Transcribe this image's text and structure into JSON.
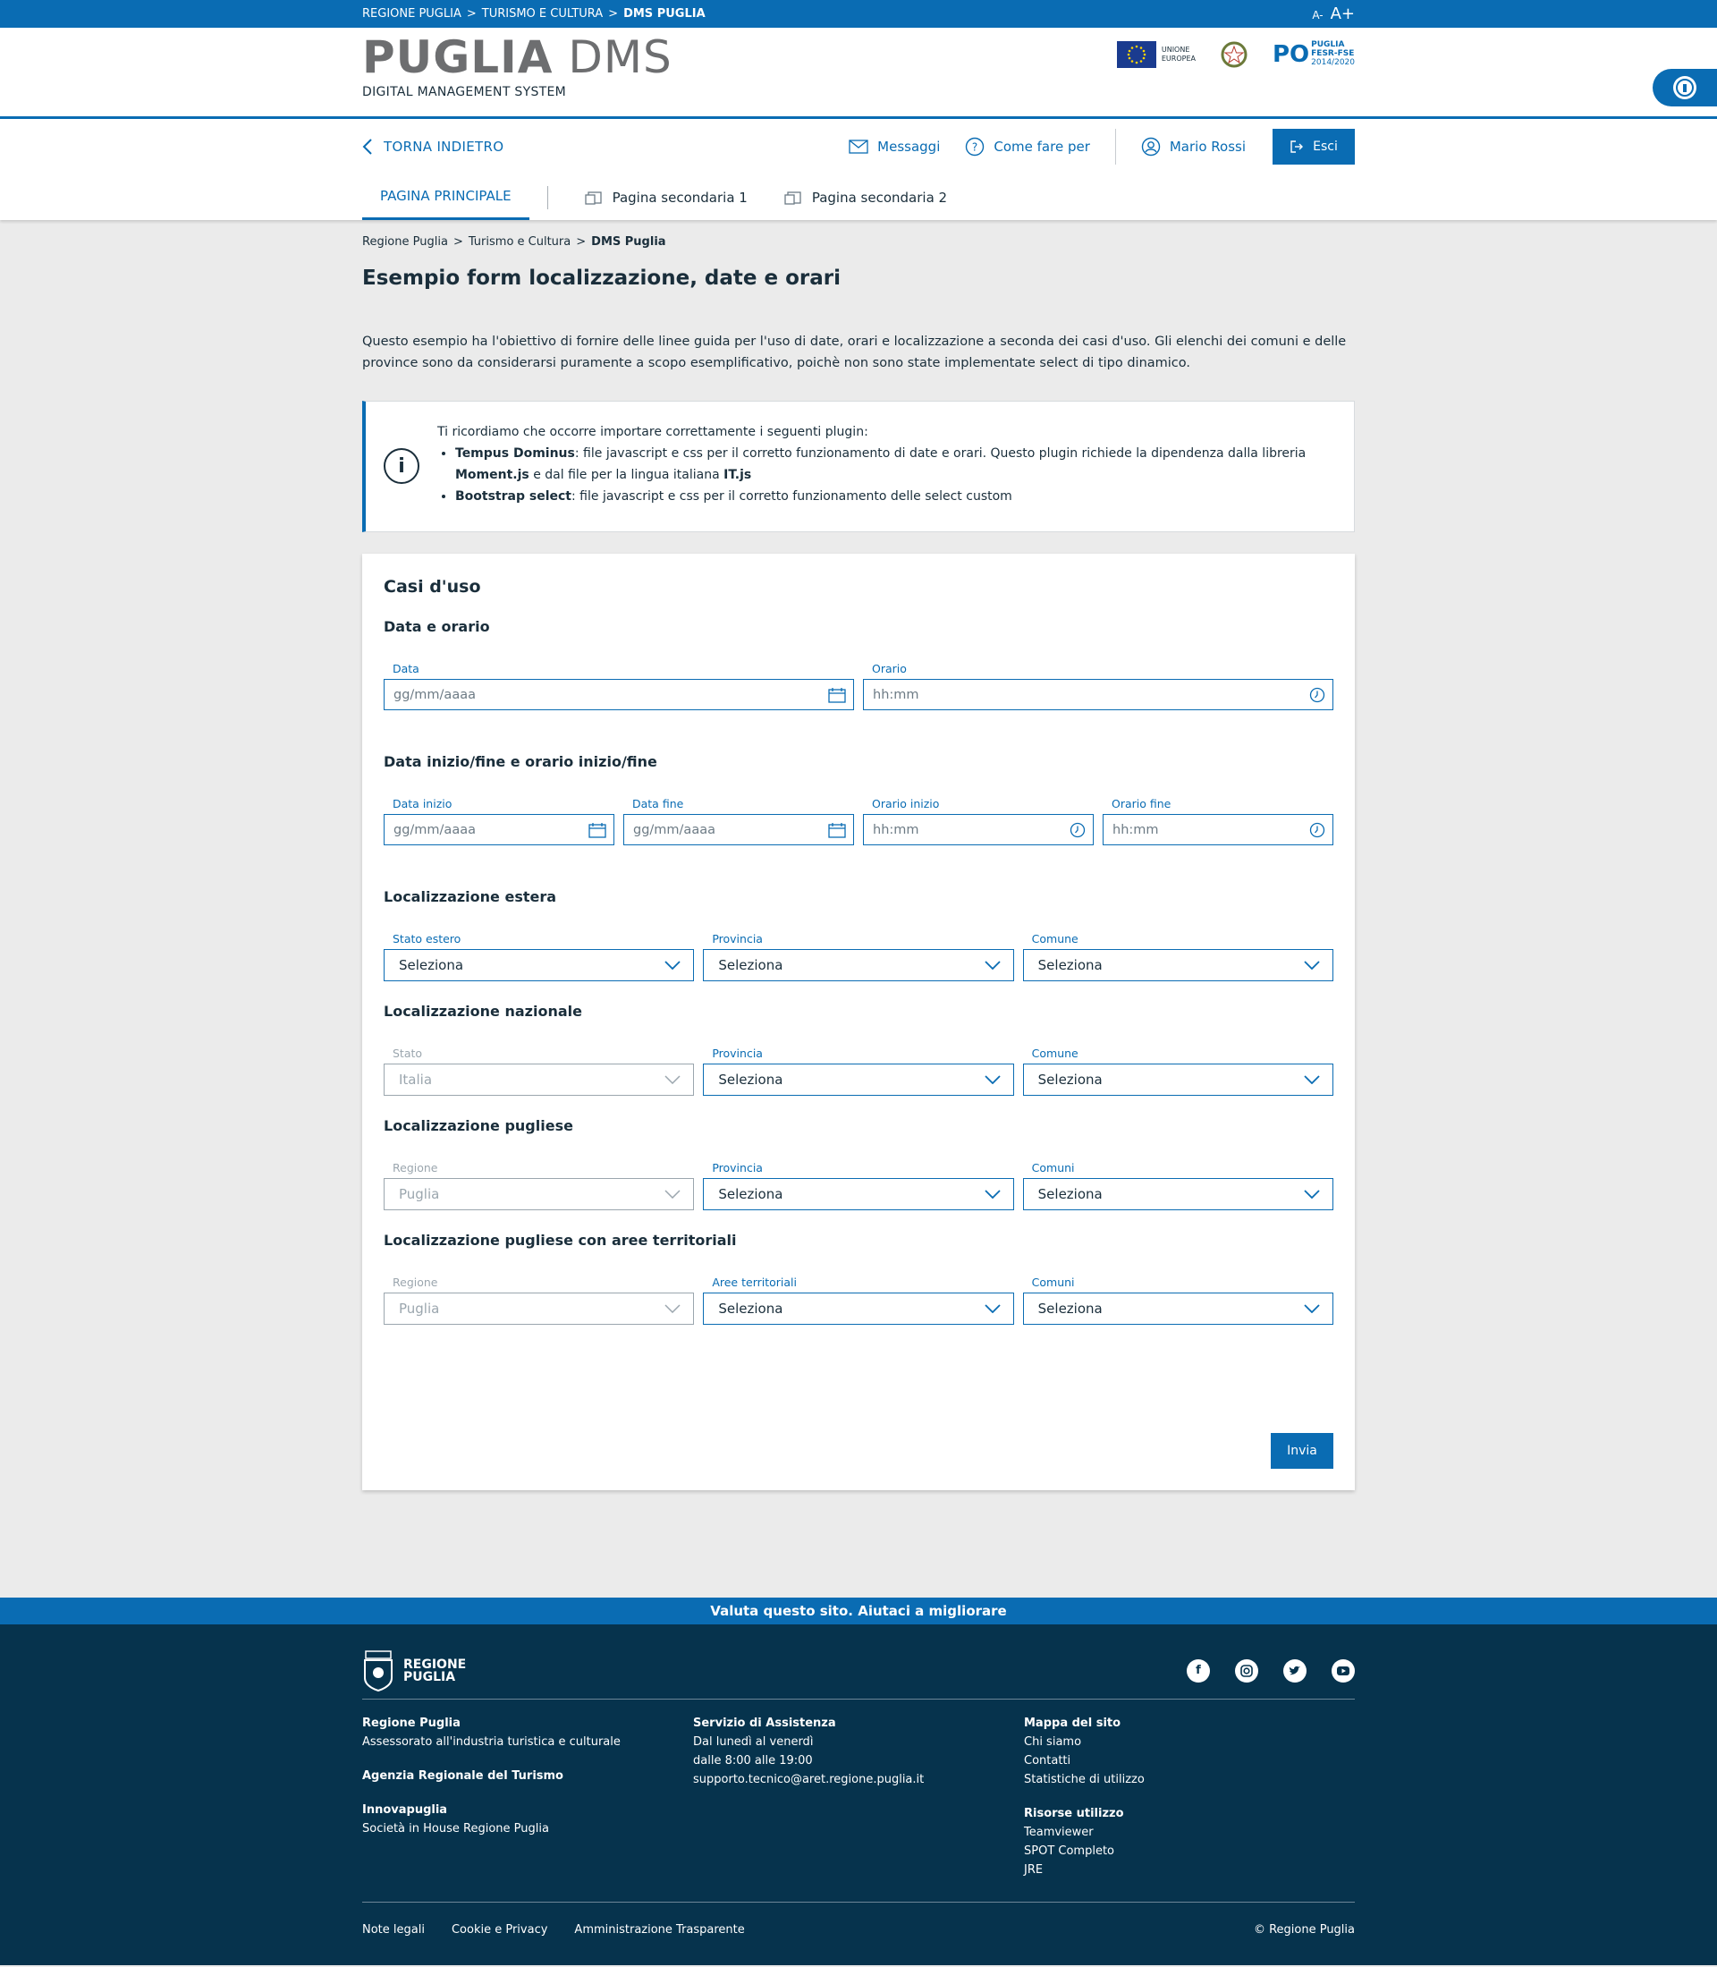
{
  "topbar": {
    "crumbs": [
      "REGIONE PUGLIA",
      "TURISMO E CULTURA",
      "DMS PUGLIA"
    ],
    "sep": ">",
    "font_smaller": "A-",
    "font_larger": "A+"
  },
  "header": {
    "logo_bold": "PUGLIA",
    "logo_light": "DMS",
    "logo_sub": "DIGITAL MANAGEMENT SYSTEM",
    "eu_line1": "UNIONE",
    "eu_line2": "EUROPEA",
    "po_letter": "PO",
    "po_line1": "PUGLIA",
    "po_line2": "FESR-FSE",
    "po_line3": "2014/2020"
  },
  "nav": {
    "back_label": "TORNA INDIETRO",
    "messages_label": "Messaggi",
    "howto_label": "Come fare per",
    "user_label": "Mario Rossi",
    "logout_label": "Esci",
    "tabs": [
      {
        "label": "PAGINA PRINCIPALE",
        "active": true
      },
      {
        "label": "Pagina secondaria 1",
        "active": false
      },
      {
        "label": "Pagina secondaria 2",
        "active": false
      }
    ]
  },
  "breadcrumb": [
    "Regione Puglia",
    "Turismo e Cultura",
    "DMS Puglia"
  ],
  "breadcrumb_sep": ">",
  "page": {
    "title": "Esempio form localizzazione, date e orari",
    "intro": "Questo esempio ha l'obiettivo di fornire delle linee guida per l'uso di date, orari e localizzazione a seconda dei casi d'uso. Gli elenchi dei comuni e delle province sono da considerarsi puramente a scopo esemplificativo, poichè non sono state implementate select di tipo dinamico."
  },
  "info": {
    "lead": "Ti ricordiamo che occorre importare correttamente i seguenti plugin:",
    "item1_bold": "Tempus Dominus",
    "item1_text": ": file javascript e css per il corretto funzionamento di date e orari. Questo plugin richiede la dipendenza dalla libreria ",
    "item1_bold2": "Moment.js",
    "item1_text2": " e dal file per la lingua italiana ",
    "item1_bold3": "IT.js",
    "item2_bold": "Bootstrap select",
    "item2_text": ": file javascript e css per il corretto funzionamento delle select custom"
  },
  "form": {
    "title": "Casi d'uso",
    "s1_title": "Data e orario",
    "s1_fields": [
      {
        "label": "Data",
        "placeholder": "gg/mm/aaaa"
      },
      {
        "label": "Orario",
        "placeholder": "hh:mm"
      }
    ],
    "s2_title": "Data inizio/fine e orario inizio/fine",
    "s2_fields": [
      {
        "label": "Data inizio",
        "placeholder": "gg/mm/aaaa"
      },
      {
        "label": "Data fine",
        "placeholder": "gg/mm/aaaa"
      },
      {
        "label": "Orario inizio",
        "placeholder": "hh:mm"
      },
      {
        "label": "Orario fine",
        "placeholder": "hh:mm"
      }
    ],
    "s3_title": "Localizzazione estera",
    "s3_fields": [
      {
        "label": "Stato estero",
        "value": "Seleziona"
      },
      {
        "label": "Provincia",
        "value": "Seleziona"
      },
      {
        "label": "Comune",
        "value": "Seleziona"
      }
    ],
    "s4_title": "Localizzazione nazionale",
    "s4_fields": [
      {
        "label": "Stato",
        "value": "Italia"
      },
      {
        "label": "Provincia",
        "value": "Seleziona"
      },
      {
        "label": "Comune",
        "value": "Seleziona"
      }
    ],
    "s5_title": "Localizzazione pugliese",
    "s5_fields": [
      {
        "label": "Regione",
        "value": "Puglia"
      },
      {
        "label": "Provincia",
        "value": "Seleziona"
      },
      {
        "label": "Comuni",
        "value": "Seleziona"
      }
    ],
    "s6_title": "Localizzazione pugliese con aree territoriali",
    "s6_fields": [
      {
        "label": "Regione",
        "value": "Puglia"
      },
      {
        "label": "Aree territoriali",
        "value": "Seleziona"
      },
      {
        "label": "Comuni",
        "value": "Seleziona"
      }
    ],
    "submit_label": "Invia"
  },
  "footer": {
    "feedback": "Valuta questo sito. Aiutaci a migliorare",
    "logo_line1": "REGIONE",
    "logo_line2": "PUGLIA",
    "col1": {
      "h1": "Regione Puglia",
      "t1": "Assessorato all'industria turistica e culturale",
      "h2": "Agenzia Regionale del Turismo",
      "h3": "Innovapuglia",
      "t3": "Società in House Regione Puglia"
    },
    "col2": {
      "h1": "Servizio di Assistenza",
      "l1": "Dal lunedì al venerdì",
      "l2": "dalle 8:00 alle 19:00",
      "l3": "supporto.tecnico@aret.regione.puglia.it"
    },
    "col3": {
      "h1": "Mappa del sito",
      "l1": "Chi siamo",
      "l2": "Contatti",
      "l3": "Statistiche di utilizzo",
      "h2": "Risorse utilizzo",
      "l4": "Teamviewer",
      "l5": "SPOT Completo",
      "l6": "JRE"
    },
    "links": [
      "Note legali",
      "Cookie e Privacy",
      "Amministrazione Trasparente"
    ],
    "copyright": "© Regione Puglia"
  },
  "colors": {
    "primary": "#0a6cb3",
    "footer_bg": "#06334d",
    "text": "#1a2e3b",
    "page_bg": "#ebebeb"
  }
}
